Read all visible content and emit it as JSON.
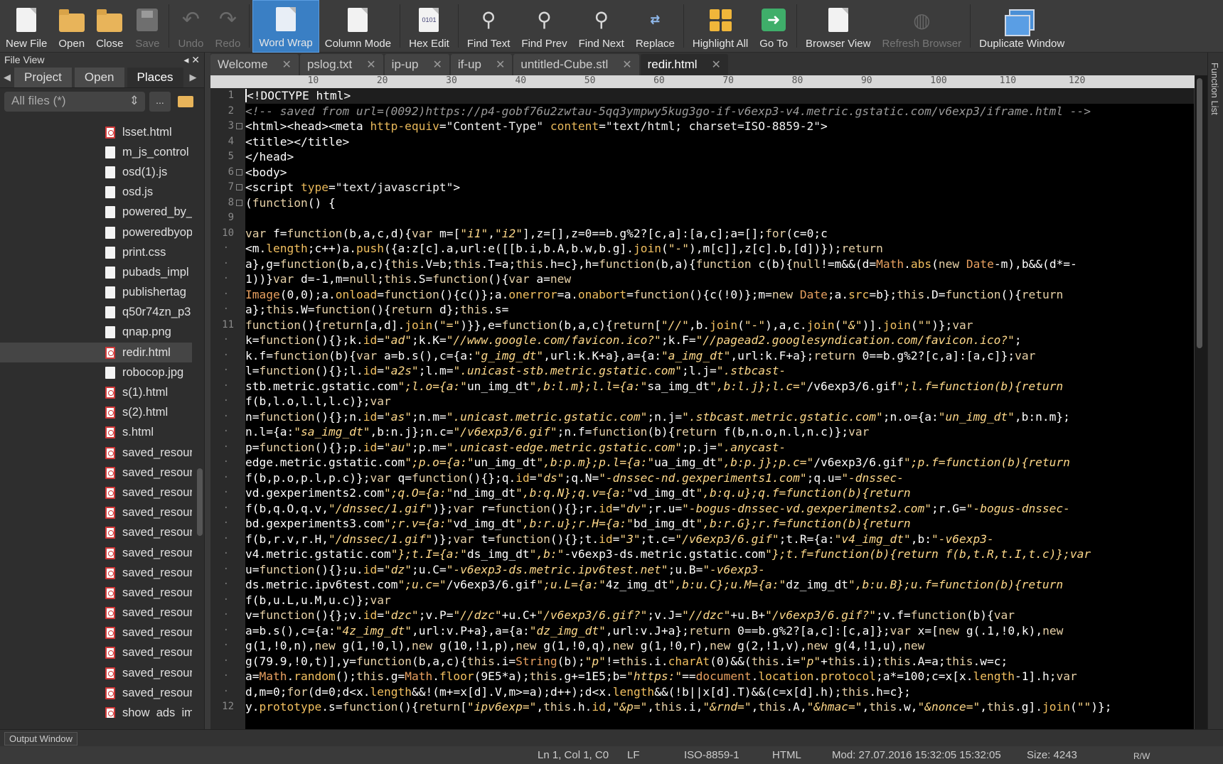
{
  "toolbar": {
    "new_file": "New File",
    "open": "Open",
    "close": "Close",
    "save": "Save",
    "undo": "Undo",
    "redo": "Redo",
    "word_wrap": "Word Wrap",
    "column_mode": "Column Mode",
    "hex_edit": "Hex Edit",
    "hex_glyph": "0101",
    "find_text": "Find Text",
    "find_prev": "Find Prev",
    "find_next": "Find Next",
    "replace": "Replace",
    "highlight_all": "Highlight All",
    "go_to": "Go To",
    "browser_view": "Browser View",
    "refresh_browser": "Refresh Browser",
    "duplicate_window": "Duplicate Window"
  },
  "fileview": {
    "title": "File View",
    "tabs": [
      "Project",
      "Open",
      "Places"
    ],
    "filter": "All files (*)",
    "more": "...",
    "files": [
      {
        "name": "lsset.html",
        "type": "html"
      },
      {
        "name": "m_js_control",
        "type": "plain"
      },
      {
        "name": "osd(1).js",
        "type": "plain"
      },
      {
        "name": "osd.js",
        "type": "plain"
      },
      {
        "name": "powered_by_",
        "type": "plain"
      },
      {
        "name": "poweredbyop",
        "type": "plain"
      },
      {
        "name": "print.css",
        "type": "plain"
      },
      {
        "name": "pubads_impl",
        "type": "plain"
      },
      {
        "name": "publishertag",
        "type": "plain"
      },
      {
        "name": "q50r74zn_p3",
        "type": "plain"
      },
      {
        "name": "qnap.png",
        "type": "plain"
      },
      {
        "name": "redir.html",
        "type": "html",
        "selected": true
      },
      {
        "name": "robocop.jpg",
        "type": "plain"
      },
      {
        "name": "s(1).html",
        "type": "html"
      },
      {
        "name": "s(2).html",
        "type": "html"
      },
      {
        "name": "s.html",
        "type": "html"
      },
      {
        "name": "saved_resour",
        "type": "html"
      },
      {
        "name": "saved_resour",
        "type": "html"
      },
      {
        "name": "saved_resour",
        "type": "html"
      },
      {
        "name": "saved_resour",
        "type": "html"
      },
      {
        "name": "saved_resour",
        "type": "html"
      },
      {
        "name": "saved_resour",
        "type": "html"
      },
      {
        "name": "saved_resour",
        "type": "html"
      },
      {
        "name": "saved_resour",
        "type": "html"
      },
      {
        "name": "saved_resour",
        "type": "html"
      },
      {
        "name": "saved_resour",
        "type": "html"
      },
      {
        "name": "saved_resour",
        "type": "html"
      },
      {
        "name": "saved_resour",
        "type": "html"
      },
      {
        "name": "saved_resour",
        "type": "html"
      },
      {
        "name": "show_ads_im",
        "type": "html"
      }
    ]
  },
  "editor": {
    "tabs": [
      "Welcome",
      "pslog.txt",
      "ip-up",
      "if-up",
      "untitled-Cube.stl",
      "redir.html"
    ],
    "active_tab": "redir.html",
    "ruler": [
      "10",
      "20",
      "30",
      "40",
      "50",
      "60",
      "70",
      "80",
      "90",
      "100",
      "110",
      "120"
    ],
    "lines": [
      {
        "n": "1",
        "t": "<!DOCTYPE html>"
      },
      {
        "n": "2",
        "t": "<!-- saved from url=(0092)https://p4-gobf76u2zwtau-5qq3ympwy5kug3go-if-v6exp3-v4.metric.gstatic.com/v6exp3/iframe.html -->"
      },
      {
        "n": "3",
        "t": "<html><head><meta http-equiv=\"Content-Type\" content=\"text/html; charset=ISO-8859-2\">"
      },
      {
        "n": "4",
        "t": "<title></title>"
      },
      {
        "n": "5",
        "t": "</head>"
      },
      {
        "n": "6",
        "t": "<body>"
      },
      {
        "n": "7",
        "t": "<script type=\"text/javascript\">"
      },
      {
        "n": "8",
        "t": "(function() {"
      },
      {
        "n": "9",
        "t": ""
      },
      {
        "n": "10",
        "t": "var f=function(b,a,c,d){var m=[\"i1\",\"i2\"],z=[],z=0==b.g%2?[c,a]:[a,c];a=[];for(c=0;c"
      },
      {
        "n": "·",
        "t": "<m.length;c++)a.push({a:z[c].a,url:e([[b.i,b.A,b.w,b.g].join(\"-\"),m[c]],z[c].b,[d])});return"
      },
      {
        "n": "·",
        "t": "a},g=function(b,a,c){this.V=b;this.T=a;this.h=c},h=function(b,a){function c(b){null!=m&&(d=Math.abs(new Date-m),b&&(d*=-"
      },
      {
        "n": "·",
        "t": "1))}var d=-1,m=null;this.S=function(){var a=new"
      },
      {
        "n": "·",
        "t": "Image(0,0);a.onload=function(){c()};a.onerror=a.onabort=function(){c(!0)};m=new Date;a.src=b};this.D=function(){return"
      },
      {
        "n": "·",
        "t": "a};this.W=function(){return d};this.s="
      },
      {
        "n": "11",
        "t": "function(){return[a,d].join(\"=\")}},e=function(b,a,c){return[\"//\",b.join(\"-\"),a,c.join(\"&\")].join(\"\")};var"
      },
      {
        "n": "·",
        "t": "k=function(){};k.id=\"ad\";k.K=\"//www.google.com/favicon.ico?\";k.F=\"//pagead2.googlesyndication.com/favicon.ico?\";"
      },
      {
        "n": "·",
        "t": "k.f=function(b){var a=b.s(),c={a:\"g_img_dt\",url:k.K+a},a={a:\"a_img_dt\",url:k.F+a};return 0==b.g%2?[c,a]:[a,c]};var"
      },
      {
        "n": "·",
        "t": "l=function(){};l.id=\"a2s\";l.m=\".unicast-stb.metric.gstatic.com\";l.j=\".stbcast-"
      },
      {
        "n": "·",
        "t": "stb.metric.gstatic.com\";l.o={a:\"un_img_dt\",b:l.m};l.l={a:\"sa_img_dt\",b:l.j};l.c=\"/v6exp3/6.gif\";l.f=function(b){return"
      },
      {
        "n": "·",
        "t": "f(b,l.o,l.l,l.c)};var"
      },
      {
        "n": "·",
        "t": "n=function(){};n.id=\"as\";n.m=\".unicast.metric.gstatic.com\";n.j=\".stbcast.metric.gstatic.com\";n.o={a:\"un_img_dt\",b:n.m};"
      },
      {
        "n": "·",
        "t": "n.l={a:\"sa_img_dt\",b:n.j};n.c=\"/v6exp3/6.gif\";n.f=function(b){return f(b,n.o,n.l,n.c)};var"
      },
      {
        "n": "·",
        "t": "p=function(){};p.id=\"au\";p.m=\".unicast-edge.metric.gstatic.com\";p.j=\".anycast-"
      },
      {
        "n": "·",
        "t": "edge.metric.gstatic.com\";p.o={a:\"un_img_dt\",b:p.m};p.l={a:\"ua_img_dt\",b:p.j};p.c=\"/v6exp3/6.gif\";p.f=function(b){return"
      },
      {
        "n": "·",
        "t": "f(b,p.o,p.l,p.c)};var q=function(){};q.id=\"ds\";q.N=\"-dnssec-nd.gexperiments1.com\";q.u=\"-dnssec-"
      },
      {
        "n": "·",
        "t": "vd.gexperiments2.com\";q.O={a:\"nd_img_dt\",b:q.N};q.v={a:\"vd_img_dt\",b:q.u};q.f=function(b){return"
      },
      {
        "n": "·",
        "t": "f(b,q.O,q.v,\"/dnssec/1.gif\")};var r=function(){};r.id=\"dv\";r.u=\"-bogus-dnssec-vd.gexperiments2.com\";r.G=\"-bogus-dnssec-"
      },
      {
        "n": "·",
        "t": "bd.gexperiments3.com\";r.v={a:\"vd_img_dt\",b:r.u};r.H={a:\"bd_img_dt\",b:r.G};r.f=function(b){return"
      },
      {
        "n": "·",
        "t": "f(b,r.v,r.H,\"/dnssec/1.gif\")};var t=function(){};t.id=\"3\";t.c=\"/v6exp3/6.gif\";t.R={a:\"v4_img_dt\",b:\"-v6exp3-"
      },
      {
        "n": "·",
        "t": "v4.metric.gstatic.com\"};t.I={a:\"ds_img_dt\",b:\"-v6exp3-ds.metric.gstatic.com\"};t.f=function(b){return f(b,t.R,t.I,t.c)};var"
      },
      {
        "n": "·",
        "t": "u=function(){};u.id=\"dz\";u.C=\"-v6exp3-ds.metric.ipv6test.net\";u.B=\"-v6exp3-"
      },
      {
        "n": "·",
        "t": "ds.metric.ipv6test.com\";u.c=\"/v6exp3/6.gif\";u.L={a:\"4z_img_dt\",b:u.C};u.M={a:\"dz_img_dt\",b:u.B};u.f=function(b){return"
      },
      {
        "n": "·",
        "t": "f(b,u.L,u.M,u.c)};var"
      },
      {
        "n": "·",
        "t": "v=function(){};v.id=\"dzc\";v.P=\"//dzc\"+u.C+\"/v6exp3/6.gif?\";v.J=\"//dzc\"+u.B+\"/v6exp3/6.gif?\";v.f=function(b){var"
      },
      {
        "n": "·",
        "t": "a=b.s(),c={a:\"4z_img_dt\",url:v.P+a},a={a:\"dz_img_dt\",url:v.J+a};return 0==b.g%2?[a,c]:[c,a]};var x=[new g(.1,!0,k),new"
      },
      {
        "n": "·",
        "t": "g(1,!0,n),new g(1,!0,l),new g(10,!1,p),new g(1,!0,q),new g(1,!0,r),new g(2,!1,v),new g(4,!1,u),new"
      },
      {
        "n": "·",
        "t": "g(79.9,!0,t)],y=function(b,a,c){this.i=String(b);\"p\"!=this.i.charAt(0)&&(this.i=\"p\"+this.i);this.A=a;this.w=c;"
      },
      {
        "n": "·",
        "t": "a=Math.random();this.g=Math.floor(9E5*a);this.g+=1E5;b=\"https:\"==document.location.protocol;a*=100;c=x[x.length-1].h;var"
      },
      {
        "n": "·",
        "t": "d,m=0;for(d=0;d<x.length&&!(m+=x[d].V,m>=a);d++);d<x.length&&(!b||x[d].T)&&(c=x[d].h);this.h=c};"
      },
      {
        "n": "12",
        "t": "y.prototype.s=function(){return[\"ipv6exp=\",this.h.id,\"&p=\",this.i,\"&rnd=\",this.A,\"&hmac=\",this.w,\"&nonce=\",this.g].join(\"\")};"
      }
    ]
  },
  "funclist": "Function List",
  "output": "Output Window",
  "status": {
    "pos": "Ln 1, Col 1, C0",
    "eol": "LF",
    "encoding": "ISO-8859-1",
    "syntax": "HTML",
    "mod": "Mod: 27.07.2016 15:32:05 15:32:05",
    "size": "Size: 4243",
    "rw": "R/W"
  }
}
